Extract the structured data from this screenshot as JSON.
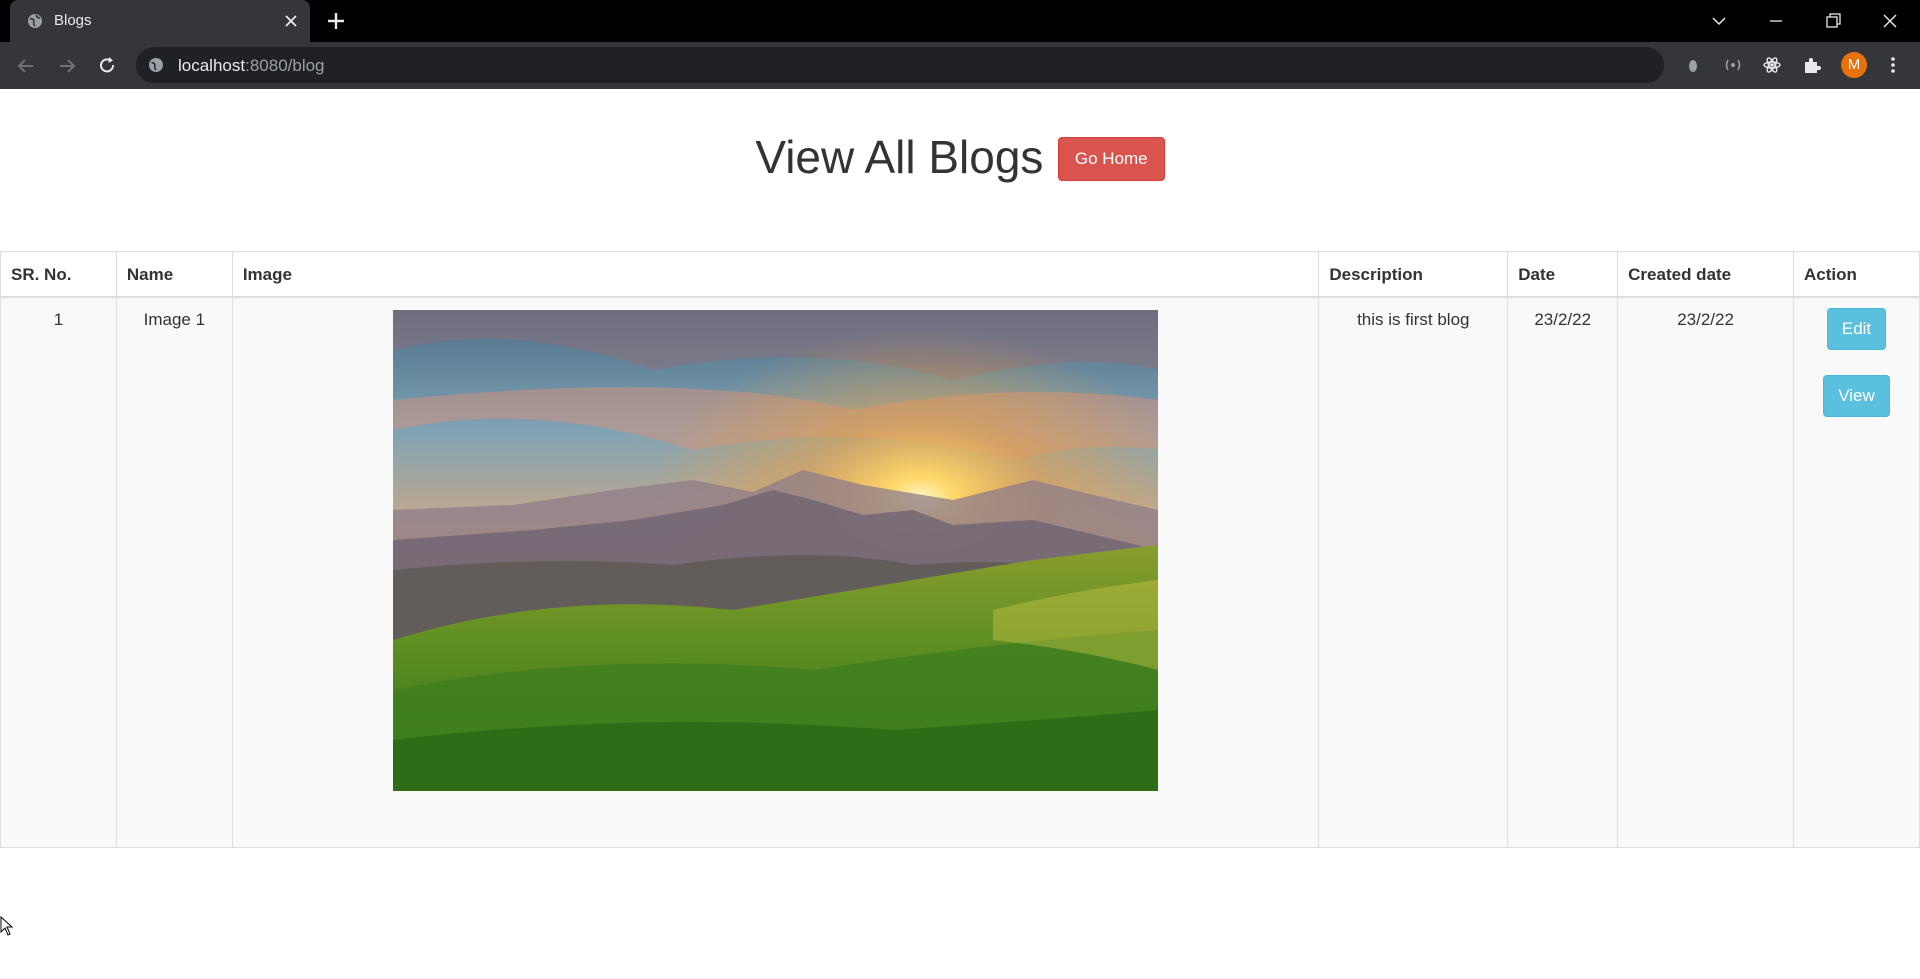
{
  "browser": {
    "tab_title": "Blogs",
    "url_host": "localhost",
    "url_rest": ":8080/blog",
    "profile_initial": "M",
    "icons": [
      "globe-icon",
      "close-icon",
      "plus-icon",
      "chevron-down-icon",
      "minimize-icon",
      "restore-icon",
      "window-close-icon",
      "back-icon",
      "forward-icon",
      "reload-icon",
      "info-icon",
      "extension-icons",
      "puzzle-icon",
      "menu-icon"
    ]
  },
  "page": {
    "title": "View All Blogs",
    "home_button": "Go Home"
  },
  "table": {
    "headers": [
      "SR. No.",
      "Name",
      "Image",
      "Description",
      "Date",
      "Created date",
      "Action"
    ],
    "rows": [
      {
        "sr": "1",
        "name": "Image 1",
        "image": "mountain-sunrise-grass-image",
        "description": "this is first blog",
        "date": "23/2/22",
        "created": "23/2/22",
        "edit_label": "Edit",
        "view_label": "View"
      }
    ]
  },
  "colors": {
    "danger": "#d9534f",
    "info": "#5bc0de",
    "chrome_dark": "#35363a",
    "table_stripe": "#f9f9f9"
  }
}
